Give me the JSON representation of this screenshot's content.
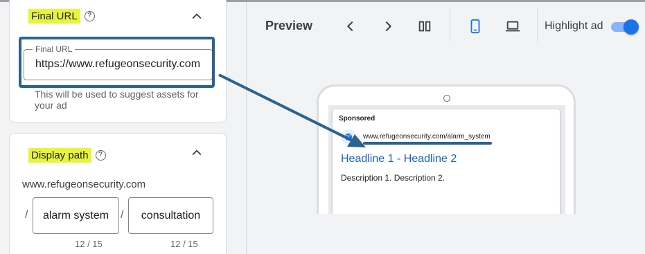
{
  "final_url_section": {
    "title": "Final URL",
    "field_label": "Final URL",
    "field_value": "https://www.refugeonsecurity.com",
    "hint": "This will be used to suggest assets for your ad"
  },
  "display_path_section": {
    "title": "Display path",
    "domain": "www.refugeonsecurity.com",
    "separator": "/",
    "path1": "alarm system",
    "path2": "consultation",
    "path1_counter": "12 / 15",
    "path2_counter": "12 / 15"
  },
  "preview": {
    "title": "Preview",
    "highlight_label": "Highlight ad",
    "highlight_on": true,
    "active_device": "mobile"
  },
  "ad": {
    "sponsored": "Sponsored",
    "url": "www.refugeonsecurity.com/alarm_system",
    "headline": "Headline 1 - Headline 2",
    "description": "Description 1. Description 2."
  },
  "colors": {
    "highlight_yellow": "#e6f53a",
    "annotation_blue": "#2b6293",
    "headline_blue": "#1a5fcc",
    "toggle_blue": "#1a73e8"
  },
  "icons": [
    "help-icon",
    "chevron-up-icon",
    "chevron-left-icon",
    "chevron-right-icon",
    "split-view-icon",
    "mobile-icon",
    "laptop-icon",
    "globe-icon"
  ]
}
